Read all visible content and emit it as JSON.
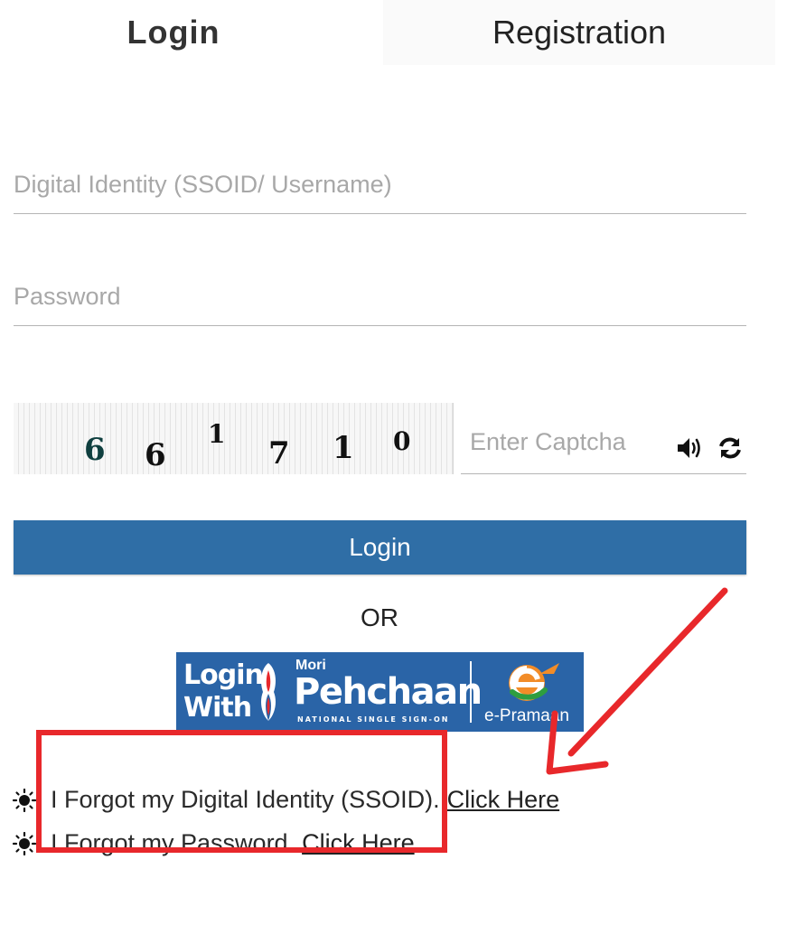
{
  "tabs": {
    "login": "Login",
    "registration": "Registration"
  },
  "form": {
    "username_placeholder": "Digital Identity (SSOID/ Username)",
    "password_placeholder": "Password",
    "captcha_placeholder": "Enter Captcha",
    "captcha_digits": [
      "6",
      "6",
      "1",
      "7",
      "1",
      "0"
    ],
    "login_button": "Login",
    "or_text": "OR"
  },
  "sso_banner": {
    "line1": "Login",
    "line2": "With",
    "mori": "Mori",
    "brand": "Pehchaan",
    "tagline": "NATIONAL SINGLE SIGN-ON",
    "partner": "e-Pramaan"
  },
  "forgot": {
    "ssoid_text": "I Forgot my Digital Identity (SSOID).",
    "ssoid_link": "Click Here",
    "password_text": "I Forgot my Password.",
    "password_link": "Click Here"
  },
  "colors": {
    "primary": "#2f6ea6",
    "banner": "#2a64a7",
    "annotation": "#e8282b"
  },
  "icons": {
    "speaker": "speaker-icon",
    "refresh": "refresh-icon",
    "bullet": "sun-icon"
  }
}
